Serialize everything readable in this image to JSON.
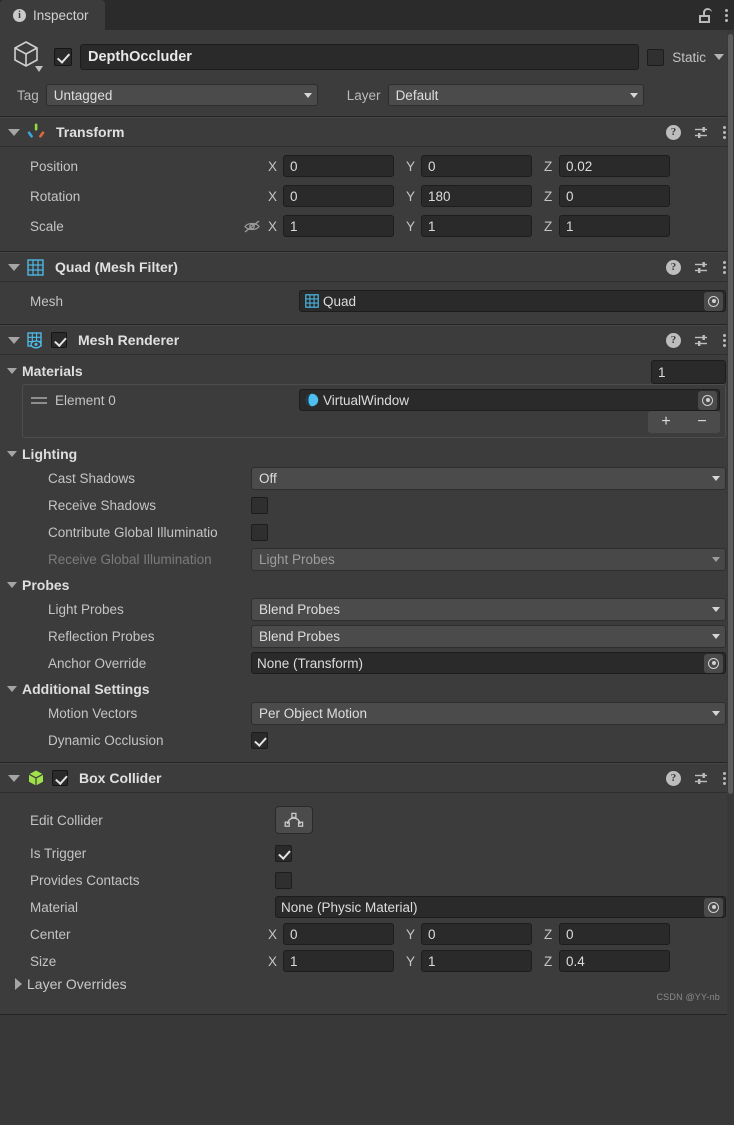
{
  "window": {
    "tab_label": "Inspector",
    "tab_icon": "info-icon",
    "lock_icon": "unlocked-padlock-icon",
    "menu_icon": "kebab-menu-icon"
  },
  "game_object": {
    "icon": "cube-gameobject-icon",
    "enabled": true,
    "name": "DepthOccluder",
    "static_checked": false,
    "static_label": "Static",
    "tag_label": "Tag",
    "tag_value": "Untagged",
    "layer_label": "Layer",
    "layer_value": "Default"
  },
  "components": [
    {
      "title": "Transform",
      "icon": "transform-axis-icon",
      "help_icon": "help-icon",
      "preset_icon": "preset-icon",
      "menu_icon": "kebab-menu-icon",
      "rows": [
        {
          "label": "Position",
          "x": "0",
          "y": "0",
          "z": "0.02"
        },
        {
          "label": "Rotation",
          "x": "0",
          "y": "180",
          "z": "0"
        },
        {
          "label": "Scale",
          "x": "1",
          "y": "1",
          "z": "1",
          "constrain_icon": "constrain-proportions-off-icon"
        }
      ],
      "axis_labels": {
        "x": "X",
        "y": "Y",
        "z": "Z"
      }
    },
    {
      "title": "Quad (Mesh Filter)",
      "icon": "mesh-filter-icon",
      "mesh_label": "Mesh",
      "mesh_value": "Quad",
      "mesh_value_icon": "mesh-icon",
      "picker_icon": "object-picker-icon"
    },
    {
      "title": "Mesh Renderer",
      "icon": "mesh-renderer-icon",
      "enabled": true,
      "materials": {
        "label": "Materials",
        "count": "1",
        "element_label": "Element 0",
        "element_value": "VirtualWindow",
        "element_value_icon": "material-ball-icon",
        "add_label": "+",
        "remove_label": "−"
      },
      "lighting": {
        "label": "Lighting",
        "cast_shadows_label": "Cast Shadows",
        "cast_shadows_value": "Off",
        "receive_shadows_label": "Receive Shadows",
        "receive_shadows_checked": false,
        "contribute_gi_label": "Contribute Global Illuminatio",
        "contribute_gi_checked": false,
        "receive_gi_label": "Receive Global Illumination",
        "receive_gi_value": "Light Probes",
        "receive_gi_disabled": true
      },
      "probes": {
        "label": "Probes",
        "light_probes_label": "Light Probes",
        "light_probes_value": "Blend Probes",
        "reflection_probes_label": "Reflection Probes",
        "reflection_probes_value": "Blend Probes",
        "anchor_override_label": "Anchor Override",
        "anchor_override_value": "None (Transform)"
      },
      "additional": {
        "label": "Additional Settings",
        "motion_vectors_label": "Motion Vectors",
        "motion_vectors_value": "Per Object Motion",
        "dynamic_occlusion_label": "Dynamic Occlusion",
        "dynamic_occlusion_checked": true
      }
    },
    {
      "title": "Box Collider",
      "icon": "box-collider-icon",
      "enabled": true,
      "edit_collider_label": "Edit Collider",
      "edit_collider_icon": "edit-collider-icon",
      "is_trigger_label": "Is Trigger",
      "is_trigger_checked": true,
      "provides_contacts_label": "Provides Contacts",
      "provides_contacts_checked": false,
      "material_label": "Material",
      "material_value": "None (Physic Material)",
      "center_label": "Center",
      "center": {
        "x": "0",
        "y": "0",
        "z": "0"
      },
      "size_label": "Size",
      "size": {
        "x": "1",
        "y": "1",
        "z": "0.4"
      },
      "layer_overrides_label": "Layer Overrides"
    }
  ],
  "watermark": "CSDN @YY-nb",
  "colors": {
    "panel_bg": "#3c3c3c",
    "window_bg": "#383838",
    "field_bg": "#2a2a2a",
    "dropdown_bg": "#4b4b4b",
    "text": "#c4c4c4",
    "accent_cyan": "#4ec0f0",
    "accent_green": "#a0e04a"
  }
}
